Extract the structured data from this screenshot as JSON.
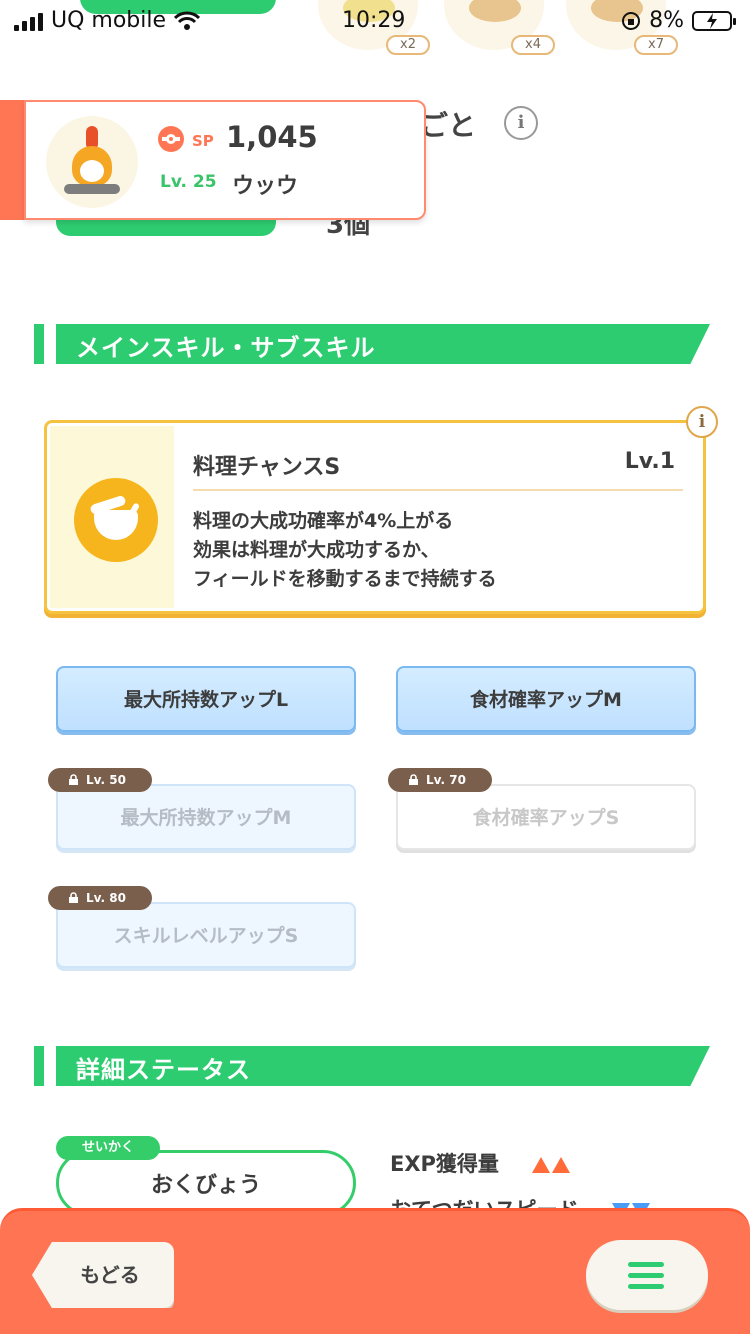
{
  "status_bar": {
    "carrier": "UQ mobile",
    "time": "10:29",
    "battery": "8%"
  },
  "food_counts": [
    "x2",
    "x4",
    "x7"
  ],
  "header": {
    "partial_title": "ごと",
    "partial_count": "3個"
  },
  "pokemon": {
    "sp_label": "SP",
    "sp_value": "1,045",
    "level": "Lv. 25",
    "name": "ウッウ"
  },
  "sections": {
    "skills_title": "メインスキル・サブスキル",
    "status_title": "詳細ステータス"
  },
  "main_skill": {
    "name": "料理チャンスS",
    "level": "Lv.1",
    "desc_line1": "料理の大成功確率が4%上がる",
    "desc_line2": "効果は料理が大成功するか、",
    "desc_line3": "フィールドを移動するまで持続する",
    "info": "i"
  },
  "sub_skills": [
    {
      "label": "最大所持数アップL"
    },
    {
      "label": "食材確率アップM"
    },
    {
      "label": "最大所持数アップM",
      "unlock": "Lv. 50"
    },
    {
      "label": "食材確率アップS",
      "unlock": "Lv. 70"
    },
    {
      "label": "スキルレベルアップS",
      "unlock": "Lv. 80"
    }
  ],
  "nature": {
    "tag": "せいかく",
    "value": "おくびょう",
    "stat_up": "EXP獲得量",
    "stat_down": "おてつだいスピード"
  },
  "bottom_bar": {
    "back_label": "もどる"
  },
  "icons": {
    "signal": "signal-icon",
    "wifi": "wifi-icon",
    "battery": "battery-charging-icon",
    "info": "info-icon",
    "sp": "sp-icon",
    "lock": "lock-icon",
    "menu": "hamburger-menu-icon",
    "pot": "cooking-pot-icon"
  },
  "colors": {
    "accent_green": "#2ecc71",
    "accent_orange": "#ff7553",
    "skill_gold": "#f6c340",
    "subskill_blue": "#7ab8f2",
    "lock_brown": "#7b5f4d"
  }
}
